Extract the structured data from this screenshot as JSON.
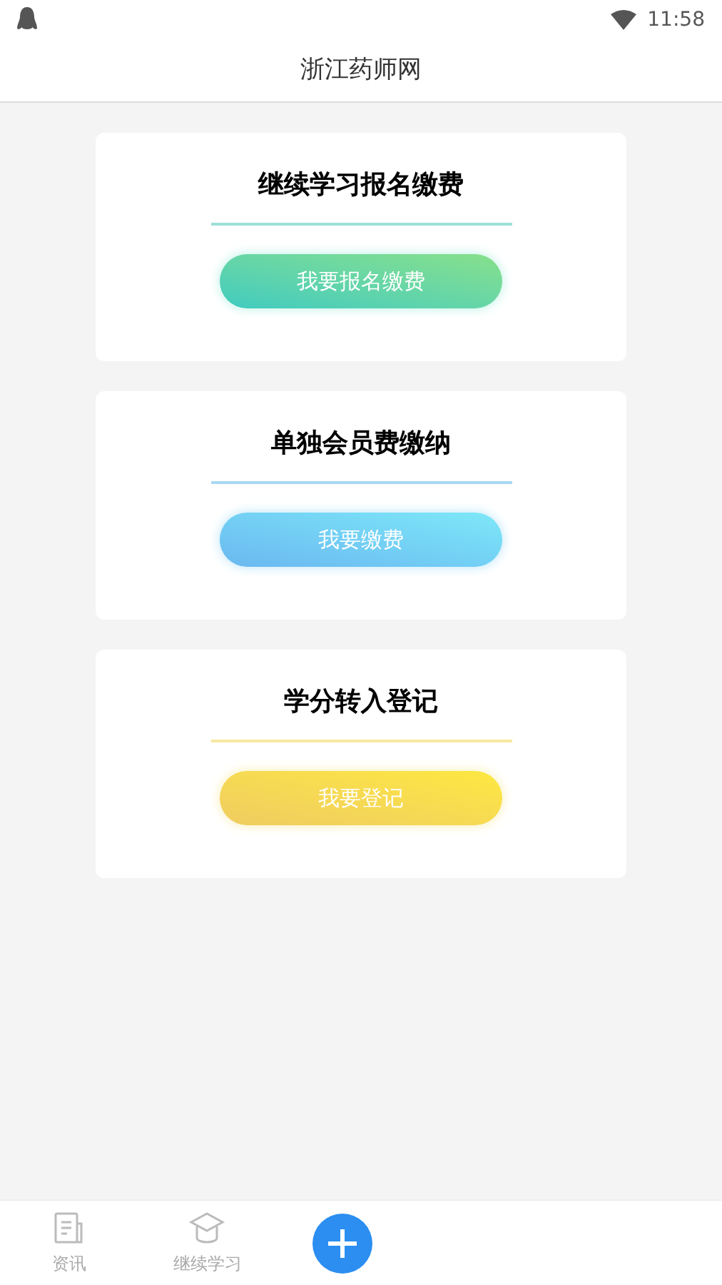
{
  "status_bar": {
    "time": "11:58"
  },
  "header": {
    "title": "浙江药师网"
  },
  "cards": [
    {
      "title": "继续学习报名缴费",
      "button": "我要报名缴费",
      "kind": "green"
    },
    {
      "title": "单独会员费缴纳",
      "button": "我要缴费",
      "kind": "blue"
    },
    {
      "title": "学分转入登记",
      "button": "我要登记",
      "kind": "yellow"
    }
  ],
  "bottom_nav": [
    {
      "label": "资讯",
      "kind": "news",
      "selected": false
    },
    {
      "label": "继续学习",
      "kind": "study",
      "selected": false
    },
    {
      "kind": "add"
    }
  ]
}
